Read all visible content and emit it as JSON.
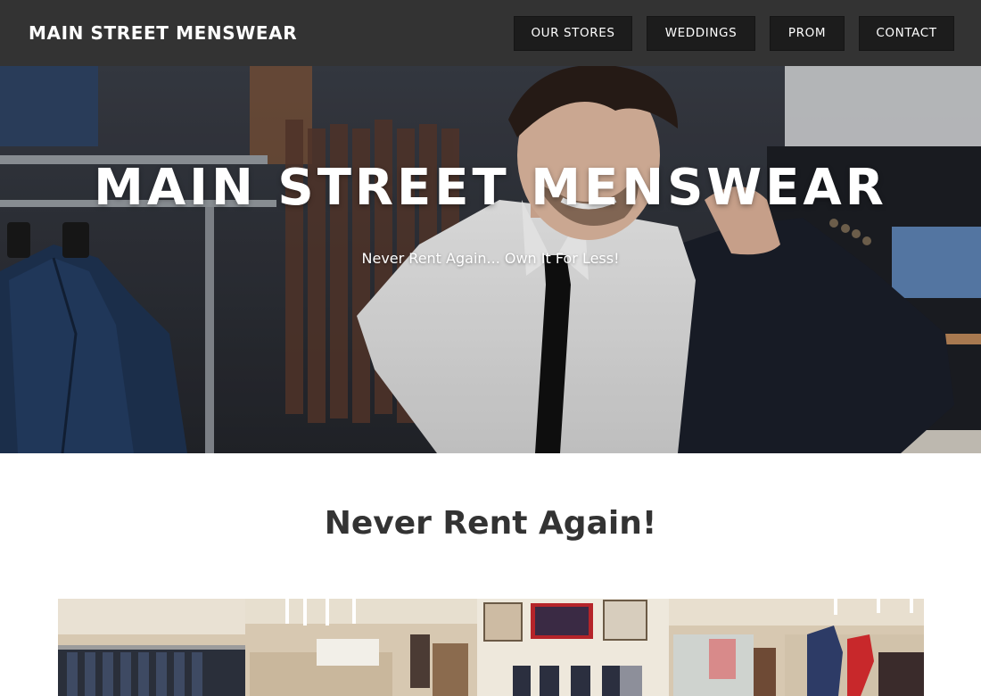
{
  "header": {
    "brand": "MAIN STREET MENSWEAR",
    "nav": [
      {
        "label": "OUR STORES"
      },
      {
        "label": "WEDDINGS"
      },
      {
        "label": "PROM"
      },
      {
        "label": "CONTACT"
      }
    ]
  },
  "hero": {
    "title": "MAIN STREET MENSWEAR",
    "subtitle": "Never Rent Again... Own It For Less!"
  },
  "main": {
    "heading": "Never Rent Again!"
  },
  "colors": {
    "header_bg": "#333333",
    "nav_button_bg": "#1c1c1c",
    "text_dark": "#333333"
  }
}
